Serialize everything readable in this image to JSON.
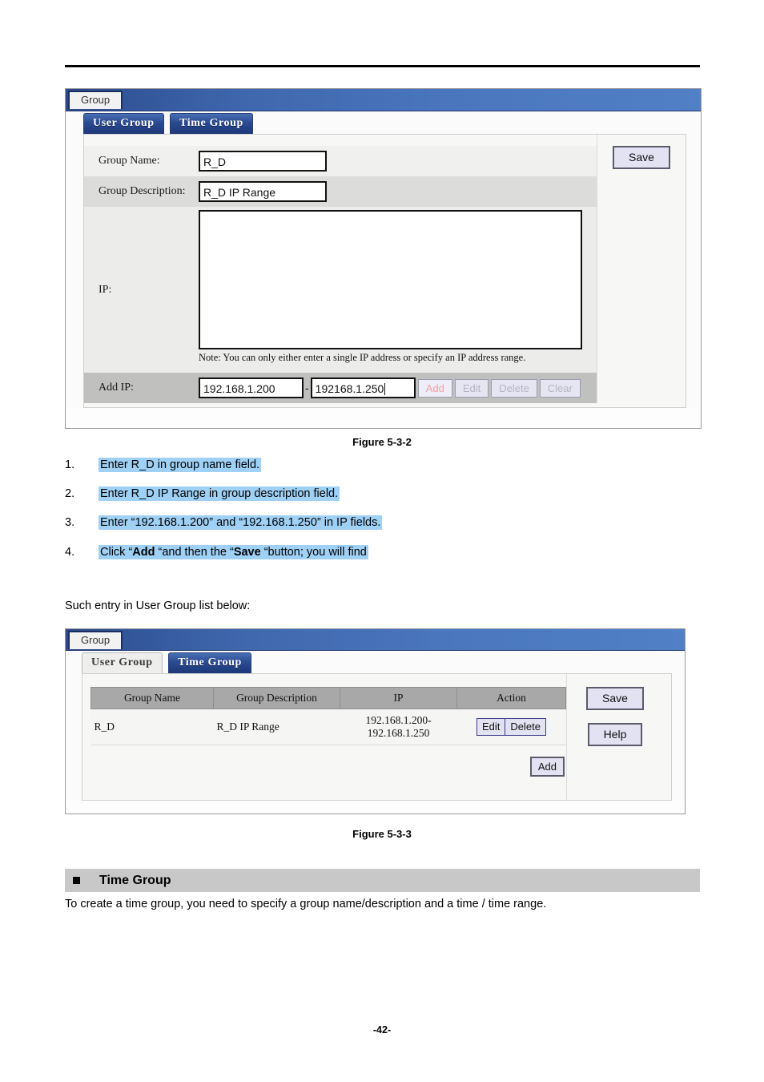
{
  "document": {
    "page_number": "-42-",
    "figure1_caption": "Figure 5-3-2",
    "figure2_caption": "Figure 5-3-3",
    "intro_line": "Such entry in User Group list below:",
    "steps": [
      {
        "index": "1.",
        "text": "Enter R_D in group name field."
      },
      {
        "index": "2.",
        "text": "Enter R_D IP Range in group description field."
      },
      {
        "index": "3.",
        "text": "Enter “192.168.1.200” and “192.168.1.250” in IP fields."
      },
      {
        "index": "4.",
        "pre": "Click “",
        "b1": "Add",
        "mid": " “and then the “",
        "b2": "Save",
        "post": " “button; you will find"
      }
    ],
    "section": {
      "title": "Time Group",
      "body": "To create a time group, you need to specify a group name/description and a time / time range."
    }
  },
  "figure1": {
    "window_tab": "Group",
    "tabs": [
      {
        "label": "User Group",
        "active": true
      },
      {
        "label": "Time Group",
        "active": true
      }
    ],
    "fields": {
      "group_name_label": "Group Name:",
      "group_name_value": "R_D",
      "group_desc_label": "Group Description:",
      "group_desc_value": "R_D IP Range",
      "ip_label": "IP:",
      "ip_textarea_value": "",
      "note": "Note: You can only either enter a single IP address or specify an IP address range.",
      "add_ip_label": "Add IP:",
      "add_ip_start": "192.168.1.200",
      "add_ip_separator": "-",
      "add_ip_end": "192168.1.250"
    },
    "row_buttons": [
      {
        "label": "Add",
        "state": "accent"
      },
      {
        "label": "Edit",
        "state": "disabled"
      },
      {
        "label": "Delete",
        "state": "disabled"
      },
      {
        "label": "Clear",
        "state": "disabled"
      }
    ],
    "side_buttons": [
      {
        "label": "Save"
      }
    ]
  },
  "figure2": {
    "window_tab": "Group",
    "tabs": [
      {
        "label": "User Group",
        "active": false
      },
      {
        "label": "Time Group",
        "active": true
      }
    ],
    "table": {
      "headers": [
        "Group Name",
        "Group Description",
        "IP",
        "Action"
      ],
      "rows": [
        {
          "group_name": "R_D",
          "group_description": "R_D IP Range",
          "ip": "192.168.1.200-192.168.1.250",
          "actions": [
            "Edit",
            "Delete"
          ]
        }
      ]
    },
    "add_button": "Add",
    "side_buttons": [
      {
        "label": "Save"
      },
      {
        "label": "Help"
      }
    ]
  },
  "colors": {
    "titlebar_blue": "#3f67ad",
    "tab_active_blue": "#2a4a91",
    "highlight_blue": "#9fd0f5",
    "band_gray": "#c8c8c8",
    "table_header_gray": "#a8a8a8",
    "accent_red": "#f0a0a0"
  }
}
